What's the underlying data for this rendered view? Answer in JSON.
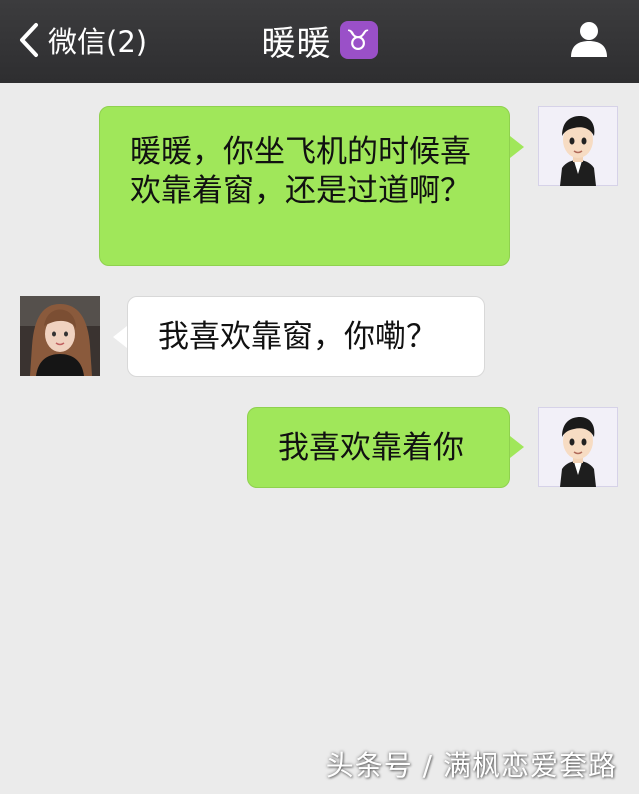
{
  "header": {
    "back_label": "微信(2)",
    "title": "暖暖",
    "zodiac_icon": "♉",
    "profile_icon": "person-icon"
  },
  "messages": [
    {
      "side": "sent",
      "text": "暖暖，你坐飞机的时候喜欢靠着窗，还是过道啊？"
    },
    {
      "side": "received",
      "text": "我喜欢靠窗，你嘞？"
    },
    {
      "side": "sent",
      "text": "我喜欢靠着你"
    }
  ],
  "watermark": "头条号 / 满枫恋爱套路",
  "colors": {
    "header_bg": "#2e2e30",
    "chat_bg": "#ebebeb",
    "sent_bubble": "#a0e75a",
    "received_bubble": "#ffffff"
  }
}
